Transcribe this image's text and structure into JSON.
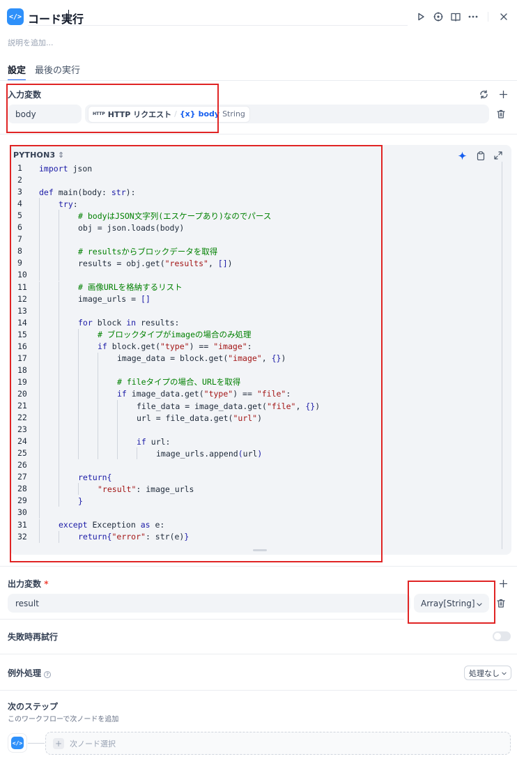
{
  "header": {
    "icon_glyph": "</>",
    "title": "コード実行",
    "description_placeholder": "説明を追加..."
  },
  "tabs": [
    {
      "label": "設定"
    },
    {
      "label": "最後の実行"
    }
  ],
  "inputs": {
    "label": "入力変数",
    "rows": [
      {
        "name": "body",
        "chip_icon": "HTTP",
        "node": "HTTP リクエスト",
        "separator": "/",
        "var_prefix": "{x}",
        "var": "body",
        "type": "String"
      }
    ]
  },
  "code": {
    "language": "PYTHON3",
    "lines": [
      {
        "n": "1",
        "indent": 0,
        "html": "<span class=\"kw\">import</span> json"
      },
      {
        "n": "2",
        "indent": 0,
        "html": ""
      },
      {
        "n": "3",
        "indent": 0,
        "html": "<span class=\"kw\">def</span> main(body: <span class=\"kw\">str</span>):"
      },
      {
        "n": "4",
        "indent": 1,
        "html": "<span class=\"kw\">try</span>:"
      },
      {
        "n": "5",
        "indent": 2,
        "html": "<span class=\"cmt\"># bodyはJSON文字列(エスケープあり)なのでパース</span>"
      },
      {
        "n": "6",
        "indent": 2,
        "html": "obj = json.loads(body)"
      },
      {
        "n": "7",
        "indent": 2,
        "html": ""
      },
      {
        "n": "8",
        "indent": 2,
        "html": "<span class=\"cmt\"># resultsからブロックデータを取得</span>"
      },
      {
        "n": "9",
        "indent": 2,
        "html": "results = obj.get(<span class=\"str\">\"results\"</span>, <span class=\"brk\">[]</span>)"
      },
      {
        "n": "10",
        "indent": 2,
        "html": ""
      },
      {
        "n": "11",
        "indent": 2,
        "html": "<span class=\"cmt\"># 画像URLを格納するリスト</span>"
      },
      {
        "n": "12",
        "indent": 2,
        "html": "image_urls = <span class=\"brk\">[]</span>"
      },
      {
        "n": "13",
        "indent": 2,
        "html": ""
      },
      {
        "n": "14",
        "indent": 2,
        "html": "<span class=\"kw\">for</span> block <span class=\"kw\">in</span> results:"
      },
      {
        "n": "15",
        "indent": 3,
        "html": "<span class=\"cmt\"># ブロックタイプがimageの場合のみ処理</span>"
      },
      {
        "n": "16",
        "indent": 3,
        "html": "<span class=\"kw\">if</span> block.get(<span class=\"str\">\"type\"</span>) == <span class=\"str\">\"image\"</span>:"
      },
      {
        "n": "17",
        "indent": 4,
        "html": "image_data = block.get(<span class=\"str\">\"image\"</span>, <span class=\"brk\">{}</span>)"
      },
      {
        "n": "18",
        "indent": 4,
        "html": ""
      },
      {
        "n": "19",
        "indent": 4,
        "html": "<span class=\"cmt\"># fileタイプの場合、URLを取得</span>"
      },
      {
        "n": "20",
        "indent": 4,
        "html": "<span class=\"kw\">if</span> image_data.get(<span class=\"str\">\"type\"</span>) == <span class=\"str\">\"file\"</span>:"
      },
      {
        "n": "21",
        "indent": 5,
        "html": "file_data = image_data.get(<span class=\"str\">\"file\"</span>, <span class=\"brk\">{}</span>)"
      },
      {
        "n": "22",
        "indent": 5,
        "html": "url = file_data.get(<span class=\"str\">\"url\"</span>)"
      },
      {
        "n": "23",
        "indent": 5,
        "html": ""
      },
      {
        "n": "24",
        "indent": 5,
        "html": "<span class=\"kw\">if</span> url:"
      },
      {
        "n": "25",
        "indent": 6,
        "html": "image_urls.append<span class=\"brk\">(</span>url<span class=\"brk\">)</span>"
      },
      {
        "n": "26",
        "indent": 2,
        "html": ""
      },
      {
        "n": "27",
        "indent": 2,
        "html": "<span class=\"kw\">return</span> <span class=\"brk\">{</span>"
      },
      {
        "n": "28",
        "indent": 3,
        "html": "<span class=\"str\">\"result\"</span>: image_urls"
      },
      {
        "n": "29",
        "indent": 2,
        "html": "<span class=\"brk\">}</span>"
      },
      {
        "n": "30",
        "indent": 1,
        "html": ""
      },
      {
        "n": "31",
        "indent": 1,
        "html": "<span class=\"kw\">except</span> Exception <span class=\"kw\">as</span> e:"
      },
      {
        "n": "32",
        "indent": 2,
        "html": "<span class=\"kw\">return</span> <span class=\"brk\">{</span><span class=\"str\">\"error\"</span>: str(e)<span class=\"brk\">}</span>"
      }
    ]
  },
  "outputs": {
    "label": "出力変数",
    "required_mark": "*",
    "rows": [
      {
        "name": "result",
        "type": "Array[String]"
      }
    ]
  },
  "retry": {
    "label": "失敗時再試行",
    "enabled": false
  },
  "exception": {
    "label": "例外処理",
    "help_glyph": "?",
    "value": "処理なし"
  },
  "next_step": {
    "label": "次のステップ",
    "sub_label": "このワークフローで次ノードを追加",
    "select_placeholder": "次ノード選択",
    "plus_glyph": "+"
  },
  "colors": {
    "accent": "#155eef",
    "node_icon": "#2e90fa",
    "highlight_box": "#e02424"
  }
}
